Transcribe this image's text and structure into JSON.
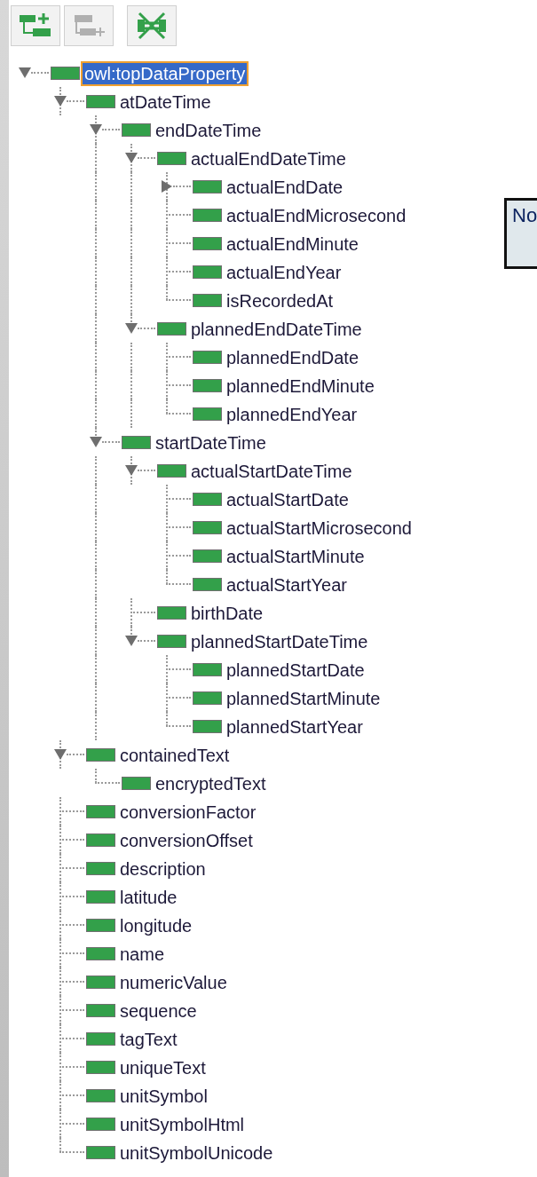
{
  "toolbar": [
    {
      "kind": "add-sub",
      "disabled": false
    },
    {
      "kind": "add-sibling",
      "disabled": true
    },
    {
      "kind": "delete",
      "disabled": false
    }
  ],
  "tree": [
    {
      "label": "owl:topDataProperty",
      "selected": true,
      "expanded": true,
      "children": [
        {
          "label": "atDateTime",
          "selected": false,
          "expanded": true,
          "children": [
            {
              "label": "endDateTime",
              "selected": false,
              "expanded": true,
              "children": [
                {
                  "label": "actualEndDateTime",
                  "selected": false,
                  "expanded": true,
                  "children": [
                    {
                      "label": "actualEndDate",
                      "selected": false,
                      "expanded": false
                    },
                    {
                      "label": "actualEndMicrosecond",
                      "selected": false
                    },
                    {
                      "label": "actualEndMinute",
                      "selected": false
                    },
                    {
                      "label": "actualEndYear",
                      "selected": false
                    },
                    {
                      "label": "isRecordedAt",
                      "selected": false
                    }
                  ]
                },
                {
                  "label": "plannedEndDateTime",
                  "selected": false,
                  "expanded": true,
                  "children": [
                    {
                      "label": "plannedEndDate",
                      "selected": false
                    },
                    {
                      "label": "plannedEndMinute",
                      "selected": false
                    },
                    {
                      "label": "plannedEndYear",
                      "selected": false
                    }
                  ]
                }
              ]
            },
            {
              "label": "startDateTime",
              "selected": false,
              "expanded": true,
              "children": [
                {
                  "label": "actualStartDateTime",
                  "selected": false,
                  "expanded": true,
                  "children": [
                    {
                      "label": "actualStartDate",
                      "selected": false
                    },
                    {
                      "label": "actualStartMicrosecond",
                      "selected": false
                    },
                    {
                      "label": "actualStartMinute",
                      "selected": false
                    },
                    {
                      "label": "actualStartYear",
                      "selected": false
                    }
                  ]
                },
                {
                  "label": "birthDate",
                  "selected": false
                },
                {
                  "label": "plannedStartDateTime",
                  "selected": false,
                  "expanded": true,
                  "children": [
                    {
                      "label": "plannedStartDate",
                      "selected": false
                    },
                    {
                      "label": "plannedStartMinute",
                      "selected": false
                    },
                    {
                      "label": "plannedStartYear",
                      "selected": false
                    }
                  ]
                }
              ]
            }
          ]
        },
        {
          "label": "containedText",
          "selected": false,
          "expanded": true,
          "children": [
            {
              "label": "encryptedText",
              "selected": false
            }
          ]
        },
        {
          "label": "conversionFactor",
          "selected": false
        },
        {
          "label": "conversionOffset",
          "selected": false
        },
        {
          "label": "description",
          "selected": false
        },
        {
          "label": "latitude",
          "selected": false
        },
        {
          "label": "longitude",
          "selected": false
        },
        {
          "label": "name",
          "selected": false
        },
        {
          "label": "numericValue",
          "selected": false
        },
        {
          "label": "sequence",
          "selected": false
        },
        {
          "label": "tagText",
          "selected": false
        },
        {
          "label": "uniqueText",
          "selected": false
        },
        {
          "label": "unitSymbol",
          "selected": false
        },
        {
          "label": "unitSymbolHtml",
          "selected": false
        },
        {
          "label": "unitSymbolUnicode",
          "selected": false
        }
      ]
    }
  ],
  "tooltip": {
    "text": "No"
  }
}
